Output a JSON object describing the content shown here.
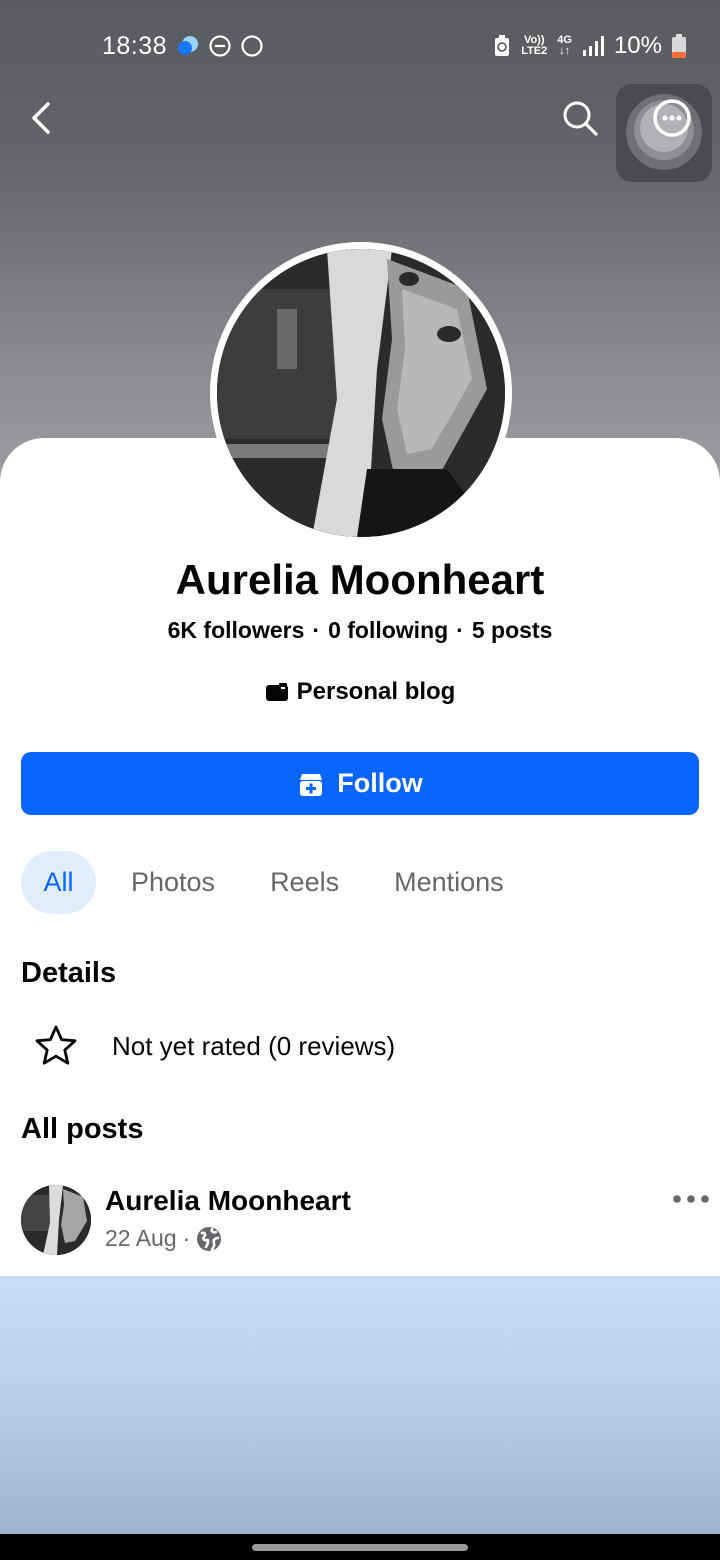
{
  "status_bar": {
    "time": "18:38",
    "network_top": "Vo))",
    "network_bottom": "LTE2",
    "data_type": "4G",
    "battery": "10%"
  },
  "profile": {
    "name": "Aurelia Moonheart",
    "followers": "6K followers",
    "following": "0 following",
    "posts": "5 posts",
    "separator": "·",
    "category": "Personal blog"
  },
  "actions": {
    "follow_label": "Follow"
  },
  "tabs": [
    {
      "label": "All",
      "active": true
    },
    {
      "label": "Photos",
      "active": false
    },
    {
      "label": "Reels",
      "active": false
    },
    {
      "label": "Mentions",
      "active": false
    }
  ],
  "details": {
    "title": "Details",
    "rating": "Not yet rated (0 reviews)"
  },
  "posts_section": {
    "title": "All posts",
    "post": {
      "author": "Aurelia Moonheart",
      "date": "22 Aug",
      "separator": "·"
    }
  },
  "colors": {
    "accent": "#0866ff",
    "tab_active_bg": "#e2edfb",
    "muted_text": "#65676b"
  }
}
